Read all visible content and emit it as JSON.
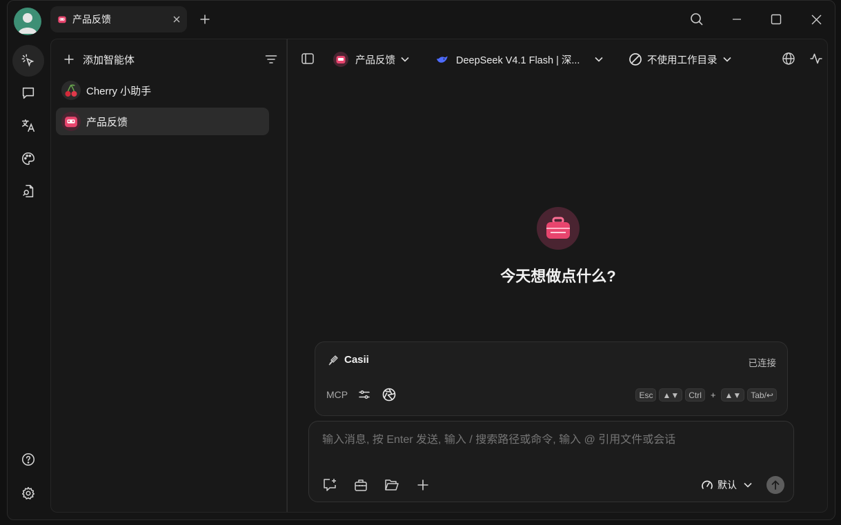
{
  "tab": {
    "title": "产品反馈"
  },
  "sidebar": {
    "add_label": "添加智能体",
    "agents": [
      {
        "name": "Cherry 小助手",
        "icon": "cherry-icon"
      },
      {
        "name": "产品反馈",
        "icon": "robot-icon"
      }
    ]
  },
  "header": {
    "agent_selector": "产品反馈",
    "model_selector": "DeepSeek V4.1 Flash | 深...",
    "workdir_selector": "不使用工作目录"
  },
  "main": {
    "greeting": "今天想做点什么?"
  },
  "plugin_card": {
    "name": "Casii",
    "status": "已连接",
    "mcp_label": "MCP",
    "shortcuts": {
      "esc": "Esc",
      "arrows1": "▲▼",
      "ctrl": "Ctrl",
      "plus": "+",
      "arrows2": "▲▼",
      "tab": "Tab/↩"
    }
  },
  "composer": {
    "placeholder": "输入消息, 按 Enter 发送, 输入 / 搜索路径或命令, 输入 @ 引用文件或会话",
    "mode": "默认"
  },
  "colors": {
    "accent_pink": "#e8456e",
    "accent_blue": "#4d6bfe",
    "avatar_green": "#3d8f75"
  }
}
